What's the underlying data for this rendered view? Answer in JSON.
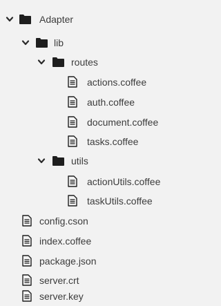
{
  "tree": {
    "root": {
      "label": "Adapter",
      "icon": "folder-icon",
      "expanded": true
    },
    "lib": {
      "label": "lib",
      "icon": "folder-icon",
      "expanded": true
    },
    "routes": {
      "label": "routes",
      "icon": "folder-icon",
      "expanded": true,
      "files": [
        {
          "label": "actions.coffee",
          "icon": "file-text-icon"
        },
        {
          "label": "auth.coffee",
          "icon": "file-text-icon"
        },
        {
          "label": "document.coffee",
          "icon": "file-text-icon"
        },
        {
          "label": "tasks.coffee",
          "icon": "file-text-icon"
        }
      ]
    },
    "utils": {
      "label": "utils",
      "icon": "folder-icon",
      "expanded": true,
      "files": [
        {
          "label": "actionUtils.coffee",
          "icon": "file-text-icon"
        },
        {
          "label": "taskUtils.coffee",
          "icon": "file-text-icon"
        }
      ]
    },
    "root_files": [
      {
        "label": "config.cson",
        "icon": "file-text-icon"
      },
      {
        "label": "index.coffee",
        "icon": "file-text-icon"
      },
      {
        "label": "package.json",
        "icon": "file-text-icon"
      },
      {
        "label": "server.crt",
        "icon": "file-text-icon"
      },
      {
        "label": "server.key",
        "icon": "file-text-icon"
      }
    ]
  },
  "colors": {
    "background": "#f2f2f2",
    "text": "#3c3c3c",
    "icon": "#1e1e1e"
  }
}
